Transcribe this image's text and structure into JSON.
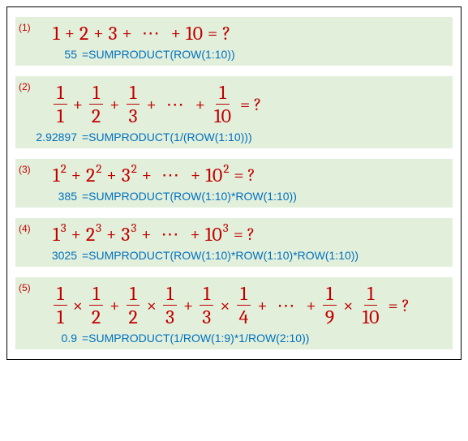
{
  "items": [
    {
      "label": "(1)",
      "equation_tokens": [
        "1",
        "+",
        "2",
        "+",
        "3",
        "+",
        "⋯",
        "+",
        "10",
        "=",
        "?"
      ],
      "result": "55",
      "formula": "=SUMPRODUCT(ROW(1:10))"
    },
    {
      "label": "(2)",
      "fractions": [
        [
          "1",
          "1"
        ],
        [
          "1",
          "2"
        ],
        [
          "1",
          "3"
        ]
      ],
      "dots": "⋯",
      "last_frac": [
        "1",
        "10"
      ],
      "op": "+",
      "tail": "= ?",
      "result": "2.92897",
      "formula": "=SUMPRODUCT(1/(ROW(1:10)))"
    },
    {
      "label": "(3)",
      "bases": [
        "1",
        "2",
        "3",
        "10"
      ],
      "exp": "2",
      "dots": "⋯",
      "tail": "= ?",
      "result": "385",
      "formula": "=SUMPRODUCT(ROW(1:10)*ROW(1:10))"
    },
    {
      "label": "(4)",
      "bases": [
        "1",
        "2",
        "3",
        "10"
      ],
      "exp": "3",
      "dots": "⋯",
      "tail": "= ?",
      "result": "3025",
      "formula": "=SUMPRODUCT(ROW(1:10)*ROW(1:10)*ROW(1:10))"
    },
    {
      "label": "(5)",
      "pairs": [
        [
          [
            "1",
            "1"
          ],
          [
            "1",
            "2"
          ]
        ],
        [
          [
            "1",
            "2"
          ],
          [
            "1",
            "3"
          ]
        ],
        [
          [
            "1",
            "3"
          ],
          [
            "1",
            "4"
          ]
        ]
      ],
      "dots": "⋯",
      "last_pair": [
        [
          "1",
          "9"
        ],
        [
          "1",
          "10"
        ]
      ],
      "op_between": "+",
      "op_mul": "×",
      "tail": "= ?",
      "result": "0.9",
      "formula": "=SUMPRODUCT(1/ROW(1:9)*1/ROW(2:10))"
    }
  ]
}
